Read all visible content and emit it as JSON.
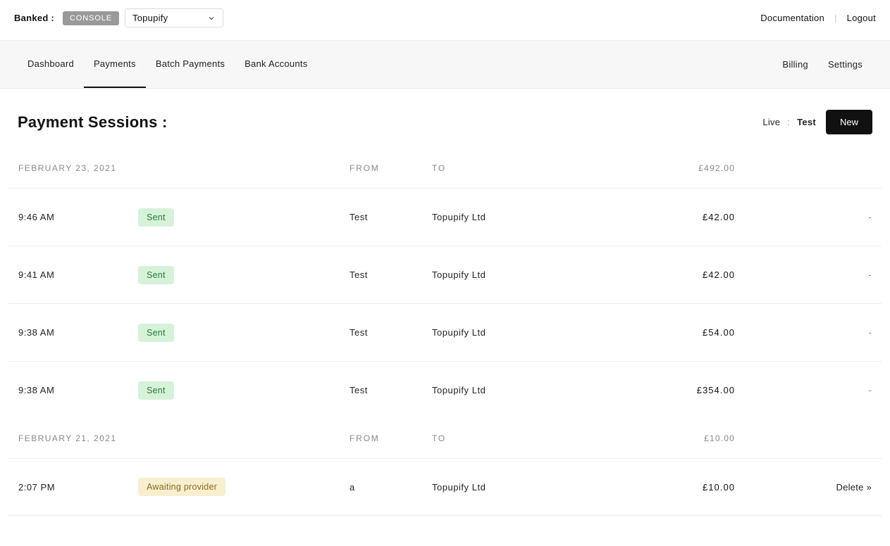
{
  "top": {
    "brand": "Banked :",
    "console_badge": "CONSOLE",
    "org_selected": "Topupify",
    "documentation": "Documentation",
    "logout": "Logout"
  },
  "nav": {
    "dashboard": "Dashboard",
    "payments": "Payments",
    "batch_payments": "Batch Payments",
    "bank_accounts": "Bank Accounts",
    "billing": "Billing",
    "settings": "Settings"
  },
  "page": {
    "title": "Payment Sessions :",
    "mode_live": "Live",
    "mode_sep": ":",
    "mode_test": "Test",
    "new_button": "New"
  },
  "columns": {
    "from": "FROM",
    "to": "TO"
  },
  "groups": [
    {
      "date": "FEBRUARY 23, 2021",
      "total": "£492.00",
      "rows": [
        {
          "time": "9:46 AM",
          "status": "Sent",
          "status_class": "sent",
          "from": "Test",
          "to": "Topupify Ltd",
          "amount": "£42.00",
          "action": "-",
          "action_class": "dash"
        },
        {
          "time": "9:41 AM",
          "status": "Sent",
          "status_class": "sent",
          "from": "Test",
          "to": "Topupify Ltd",
          "amount": "£42.00",
          "action": "-",
          "action_class": "dash"
        },
        {
          "time": "9:38 AM",
          "status": "Sent",
          "status_class": "sent",
          "from": "Test",
          "to": "Topupify Ltd",
          "amount": "£54.00",
          "action": "-",
          "action_class": "dash"
        },
        {
          "time": "9:38 AM",
          "status": "Sent",
          "status_class": "sent",
          "from": "Test",
          "to": "Topupify Ltd",
          "amount": "£354.00",
          "action": "-",
          "action_class": "dash"
        }
      ]
    },
    {
      "date": "FEBRUARY 21, 2021",
      "total": "£10.00",
      "rows": [
        {
          "time": "2:07 PM",
          "status": "Awaiting provider",
          "status_class": "awaiting",
          "from": "a",
          "to": "Topupify Ltd",
          "amount": "£10.00",
          "action": "Delete »",
          "action_class": "delete"
        }
      ]
    }
  ]
}
